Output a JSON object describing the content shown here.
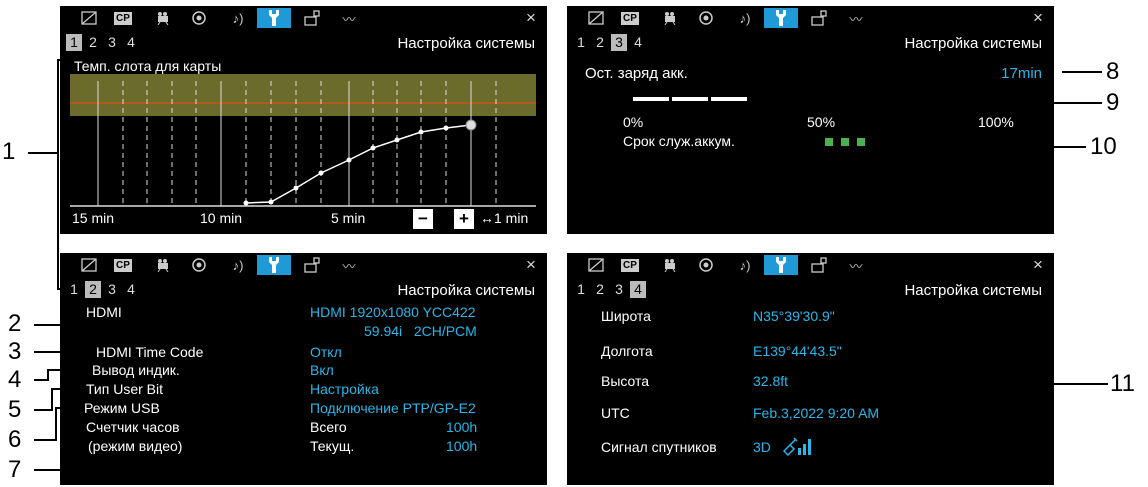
{
  "colors": {
    "active_tab": "#1f9ad6",
    "value_text": "#29b6e8",
    "bar_green": "#4caf50",
    "band_olive": "#6b6b2c",
    "limit_line": "#c8541a"
  },
  "tabs": [
    {
      "name": "camera-icon"
    },
    {
      "name": "custom-picture-icon",
      "label": "CP"
    },
    {
      "name": "recording-icon"
    },
    {
      "name": "assist-icon"
    },
    {
      "name": "audio-icon",
      "label": "♪)"
    },
    {
      "name": "wrench-icon"
    },
    {
      "name": "custom-menu-icon"
    },
    {
      "name": "network-icon",
      "label": "〰"
    }
  ],
  "close_label": "×",
  "title": "Настройка системы",
  "pages": [
    "1",
    "2",
    "3",
    "4"
  ],
  "p1": {
    "heading": "Темп. слота для карты",
    "x_labels": [
      "15 min",
      "10 min",
      "5 min"
    ],
    "minus": "−",
    "plus": "+",
    "scale_label": "↔1 min"
  },
  "p3": {
    "battery_label": "Ост. заряд акк.",
    "battery_value": "17min",
    "scale": [
      "0%",
      "50%",
      "100%"
    ],
    "life_label": "Срок служ.аккум.",
    "life_level": "3"
  },
  "p2": {
    "rows": [
      {
        "label": "HDMI",
        "value": "HDMI 1920x1080 YCC422",
        "value2": "59.94i   2CH/PCM"
      },
      {
        "label": "HDMI Time Code",
        "value": "Откл"
      },
      {
        "label": "Вывод индик.",
        "value": "Вкл"
      },
      {
        "label": "Тип User Bit",
        "value": "Настройка"
      },
      {
        "label": "Режим USB",
        "value": "Подключение PTP/GP-E2"
      },
      {
        "label": "Счетчик часов",
        "label2": "(режим видео)",
        "sub1": "Всего",
        "val1": "100h",
        "sub2": "Текущ.",
        "val2": "100h"
      }
    ]
  },
  "p4": {
    "rows": [
      {
        "label": "Широта",
        "value": "N35°39'30.9\""
      },
      {
        "label": "Долгота",
        "value": "E139°44'43.5\""
      },
      {
        "label": "Высота",
        "value": "32.8ft"
      },
      {
        "label": "UTC",
        "value": "Feb.3,2022 9:20 AM"
      },
      {
        "label": "Сигнал спутников",
        "value": "3D"
      }
    ]
  },
  "callouts": [
    "1",
    "2",
    "3",
    "4",
    "5",
    "6",
    "7",
    "8",
    "9",
    "10",
    "11"
  ]
}
